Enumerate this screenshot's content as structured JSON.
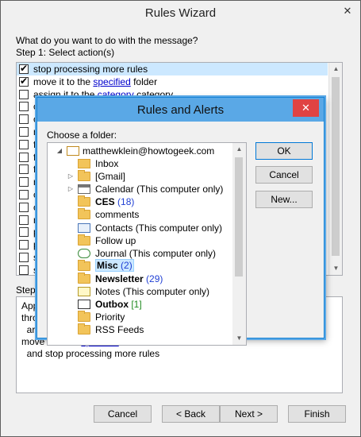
{
  "window": {
    "title": "Rules Wizard",
    "close_glyph": "✕"
  },
  "question": "What do you want to do with the message?",
  "step1_label": "Step 1: Select action(s)",
  "actions": [
    {
      "text": "stop processing more rules",
      "checked": true,
      "selected": true
    },
    {
      "pre": "move it to the ",
      "link": "specified",
      "post": " folder",
      "checked": true
    },
    {
      "pre": "assign it to the ",
      "link": "category",
      "post": " category",
      "checked": false
    },
    {
      "text": "c",
      "checked": false
    },
    {
      "text": "c",
      "checked": false
    },
    {
      "text": "n",
      "checked": false
    },
    {
      "text": "f",
      "checked": false
    },
    {
      "text": "f",
      "checked": false
    },
    {
      "text": "f",
      "checked": false
    },
    {
      "text": "r",
      "checked": false
    },
    {
      "text": "c",
      "checked": false
    },
    {
      "text": "c",
      "checked": false
    },
    {
      "text": "n",
      "checked": false
    },
    {
      "text": "p",
      "checked": false
    },
    {
      "text": "p",
      "checked": false
    },
    {
      "text": "s",
      "checked": false
    },
    {
      "text": "s",
      "checked": false
    },
    {
      "text": "r",
      "checked": false
    }
  ],
  "step2_label": "Step",
  "description": {
    "lines": [
      {
        "text": "App"
      },
      {
        "text": "thro"
      },
      {
        "text": "  ar"
      },
      {
        "pre": "move it to the ",
        "link": "specified",
        "post": " folder"
      },
      {
        "text": "  and stop processing more rules"
      }
    ]
  },
  "buttons": {
    "cancel": "Cancel",
    "back": "< Back",
    "next": "Next >",
    "finish": "Finish"
  },
  "dialog": {
    "title": "Rules and Alerts",
    "close_glyph": "✕",
    "choose_label": "Choose a folder:",
    "ok": "OK",
    "cancel": "Cancel",
    "new": "New...",
    "account": "matthewklein@howtogeek.com",
    "folders": [
      {
        "name": "Inbox",
        "icon": "inbox-icon",
        "bold": false,
        "expander": ""
      },
      {
        "name": "[Gmail]",
        "icon": "folder-icon",
        "bold": false,
        "expander": "▷"
      },
      {
        "name": "Calendar (This computer only)",
        "icon": "calendar-icon",
        "bold": false,
        "expander": "▷"
      },
      {
        "name": "CES",
        "icon": "folder-icon",
        "bold": true,
        "count": "(18)",
        "count_color": "blue",
        "expander": ""
      },
      {
        "name": "comments",
        "icon": "folder-icon",
        "bold": false,
        "expander": ""
      },
      {
        "name": "Contacts (This computer only)",
        "icon": "contacts-icon",
        "bold": false,
        "expander": ""
      },
      {
        "name": "Follow up",
        "icon": "folder-icon",
        "bold": false,
        "expander": ""
      },
      {
        "name": "Journal (This computer only)",
        "icon": "journal-icon",
        "bold": false,
        "expander": ""
      },
      {
        "name": "Misc",
        "icon": "folder-icon",
        "bold": true,
        "count": "(2)",
        "count_color": "blue",
        "expander": "",
        "selected": true
      },
      {
        "name": "Newsletter",
        "icon": "folder-icon",
        "bold": true,
        "count": "(29)",
        "count_color": "blue",
        "expander": ""
      },
      {
        "name": "Notes (This computer only)",
        "icon": "notes-icon",
        "bold": false,
        "expander": ""
      },
      {
        "name": "Outbox",
        "icon": "outbox-icon",
        "bold": true,
        "count": "[1]",
        "count_color": "green",
        "expander": ""
      },
      {
        "name": "Priority",
        "icon": "folder-icon",
        "bold": false,
        "expander": ""
      },
      {
        "name": "RSS Feeds",
        "icon": "folder-icon",
        "bold": false,
        "expander": ""
      }
    ]
  },
  "colors": {
    "selection": "#cce8ff",
    "dialog_title": "#5aa8e6",
    "close_red": "#e04343",
    "link": "#0000cc"
  }
}
